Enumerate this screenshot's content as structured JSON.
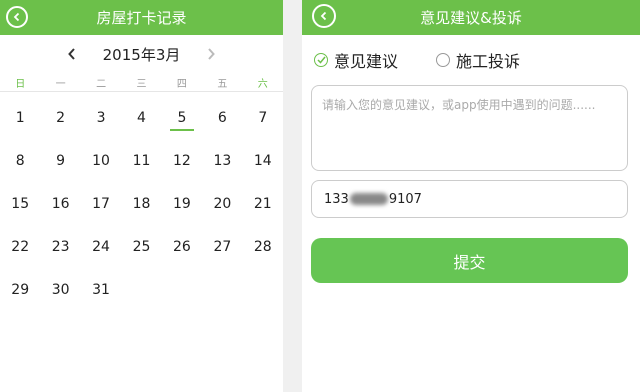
{
  "colors": {
    "accent": "#6cc04a",
    "accent_alt": "#66c554"
  },
  "left": {
    "header": {
      "title": "房屋打卡记录",
      "back_icon": "chevron-left-circle-icon"
    },
    "calendar": {
      "month_label": "2015年3月",
      "prev_icon": "chevron-left-icon",
      "next_icon": "chevron-right-icon",
      "weekdays": [
        "日",
        "一",
        "二",
        "三",
        "四",
        "五",
        "六"
      ],
      "selected_day": "5",
      "weeks": [
        [
          "1",
          "2",
          "3",
          "4",
          "5",
          "6",
          "7"
        ],
        [
          "8",
          "9",
          "10",
          "11",
          "12",
          "13",
          "14"
        ],
        [
          "15",
          "16",
          "17",
          "18",
          "19",
          "20",
          "21"
        ],
        [
          "22",
          "23",
          "24",
          "25",
          "26",
          "27",
          "28"
        ],
        [
          "29",
          "30",
          "31",
          "",
          "",
          "",
          ""
        ]
      ]
    }
  },
  "right": {
    "header": {
      "title": "意见建议&投诉",
      "back_icon": "chevron-left-circle-icon"
    },
    "radio_options": [
      {
        "label": "意见建议",
        "checked": true,
        "icon": "check-circle-icon"
      },
      {
        "label": "施工投诉",
        "checked": false,
        "icon": "radio-empty-icon"
      }
    ],
    "feedback_placeholder": "请输入您的意见建议，或app使用中遇到的问题......",
    "phone": {
      "prefix": "133",
      "suffix": "9107"
    },
    "submit_label": "提交"
  }
}
